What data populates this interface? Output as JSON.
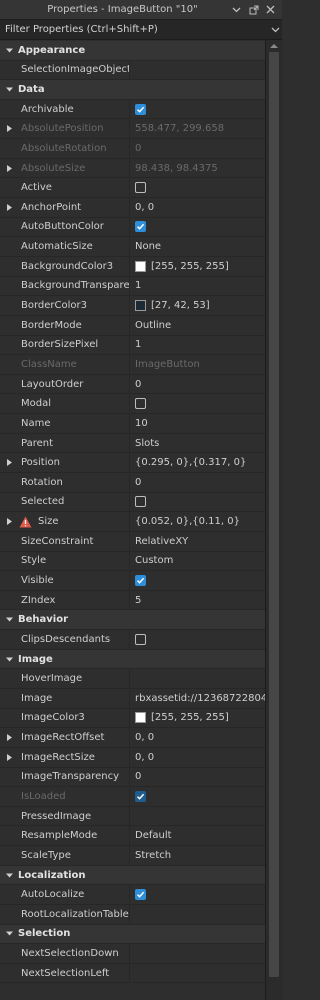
{
  "window": {
    "title": "Properties - ImageButton \"10\""
  },
  "filter": {
    "placeholder": "Filter Properties (Ctrl+Shift+P)"
  },
  "colors": {
    "accent": "#2e8ed8",
    "warning": "#e05b4b",
    "background_color3": "#ffffff",
    "border_color3": "#1b2a35",
    "image_color3": "#ffffff"
  },
  "sections": [
    {
      "type": "cat",
      "key": "appearance",
      "label": "Appearance"
    },
    {
      "type": "row",
      "key": "selectionimageobject",
      "name": "SelectionImageObject",
      "value": ""
    },
    {
      "type": "cat",
      "key": "data",
      "label": "Data"
    },
    {
      "type": "row",
      "key": "archivable",
      "name": "Archivable",
      "checkbox": true
    },
    {
      "type": "row",
      "key": "absoluteposition",
      "name": "AbsolutePosition",
      "value": "558.477, 299.658",
      "expandable": true,
      "disabled": true
    },
    {
      "type": "row",
      "key": "absoluterotation",
      "name": "AbsoluteRotation",
      "value": "0",
      "disabled": true
    },
    {
      "type": "row",
      "key": "absolutesize",
      "name": "AbsoluteSize",
      "value": "98.438, 98.4375",
      "expandable": true,
      "disabled": true
    },
    {
      "type": "row",
      "key": "active",
      "name": "Active",
      "checkbox": false
    },
    {
      "type": "row",
      "key": "anchorpoint",
      "name": "AnchorPoint",
      "value": "0, 0",
      "expandable": true
    },
    {
      "type": "row",
      "key": "autobuttoncolor",
      "name": "AutoButtonColor",
      "checkbox": true
    },
    {
      "type": "row",
      "key": "automaticsize",
      "name": "AutomaticSize",
      "value": "None"
    },
    {
      "type": "row",
      "key": "backgroundcolor3",
      "name": "BackgroundColor3",
      "value": "[255, 255, 255]",
      "swatch": "#ffffff"
    },
    {
      "type": "row",
      "key": "backgroundtransparency",
      "name": "BackgroundTranspare...",
      "value": "1"
    },
    {
      "type": "row",
      "key": "bordercolor3",
      "name": "BorderColor3",
      "value": "[27, 42, 53]",
      "swatch": "#1b2a35"
    },
    {
      "type": "row",
      "key": "bordermode",
      "name": "BorderMode",
      "value": "Outline"
    },
    {
      "type": "row",
      "key": "bordersizepixel",
      "name": "BorderSizePixel",
      "value": "1"
    },
    {
      "type": "row",
      "key": "classname",
      "name": "ClassName",
      "value": "ImageButton",
      "disabled": true
    },
    {
      "type": "row",
      "key": "layoutorder",
      "name": "LayoutOrder",
      "value": "0"
    },
    {
      "type": "row",
      "key": "modal",
      "name": "Modal",
      "checkbox": false
    },
    {
      "type": "row",
      "key": "name",
      "name": "Name",
      "value": "10"
    },
    {
      "type": "row",
      "key": "parent",
      "name": "Parent",
      "value": "Slots"
    },
    {
      "type": "row",
      "key": "position",
      "name": "Position",
      "value": "{0.295, 0},{0.317, 0}",
      "expandable": true
    },
    {
      "type": "row",
      "key": "rotation",
      "name": "Rotation",
      "value": "0"
    },
    {
      "type": "row",
      "key": "selected",
      "name": "Selected",
      "checkbox": false
    },
    {
      "type": "row",
      "key": "size",
      "name": "Size",
      "value": "{0.052, 0},{0.11, 0}",
      "expandable": true,
      "warning": true
    },
    {
      "type": "row",
      "key": "sizeconstraint",
      "name": "SizeConstraint",
      "value": "RelativeXY"
    },
    {
      "type": "row",
      "key": "style",
      "name": "Style",
      "value": "Custom"
    },
    {
      "type": "row",
      "key": "visible",
      "name": "Visible",
      "checkbox": true
    },
    {
      "type": "row",
      "key": "zindex",
      "name": "ZIndex",
      "value": "5"
    },
    {
      "type": "cat",
      "key": "behavior",
      "label": "Behavior"
    },
    {
      "type": "row",
      "key": "clipsdescendants",
      "name": "ClipsDescendants",
      "checkbox": false
    },
    {
      "type": "cat",
      "key": "image",
      "label": "Image"
    },
    {
      "type": "row",
      "key": "hoverimage",
      "name": "HoverImage",
      "value": ""
    },
    {
      "type": "row",
      "key": "image",
      "name": "Image",
      "value": "rbxassetid://12368722804"
    },
    {
      "type": "row",
      "key": "imagecolor3",
      "name": "ImageColor3",
      "value": "[255, 255, 255]",
      "swatch": "#ffffff"
    },
    {
      "type": "row",
      "key": "imagerectoffset",
      "name": "ImageRectOffset",
      "value": "0, 0",
      "expandable": true
    },
    {
      "type": "row",
      "key": "imagerectsize",
      "name": "ImageRectSize",
      "value": "0, 0",
      "expandable": true
    },
    {
      "type": "row",
      "key": "imagetransparency",
      "name": "ImageTransparency",
      "value": "0"
    },
    {
      "type": "row",
      "key": "isloaded",
      "name": "IsLoaded",
      "checkbox": true,
      "disabled": true
    },
    {
      "type": "row",
      "key": "pressedimage",
      "name": "PressedImage",
      "value": ""
    },
    {
      "type": "row",
      "key": "resamplemode",
      "name": "ResampleMode",
      "value": "Default"
    },
    {
      "type": "row",
      "key": "scaletype",
      "name": "ScaleType",
      "value": "Stretch"
    },
    {
      "type": "cat",
      "key": "localization",
      "label": "Localization"
    },
    {
      "type": "row",
      "key": "autolocalize",
      "name": "AutoLocalize",
      "checkbox": true
    },
    {
      "type": "row",
      "key": "rootlocalizationtable",
      "name": "RootLocalizationTable",
      "value": ""
    },
    {
      "type": "cat",
      "key": "selection",
      "label": "Selection"
    },
    {
      "type": "row",
      "key": "nextselectiondown",
      "name": "NextSelectionDown",
      "value": ""
    },
    {
      "type": "row",
      "key": "nextselectionleft",
      "name": "NextSelectionLeft",
      "value": ""
    }
  ]
}
